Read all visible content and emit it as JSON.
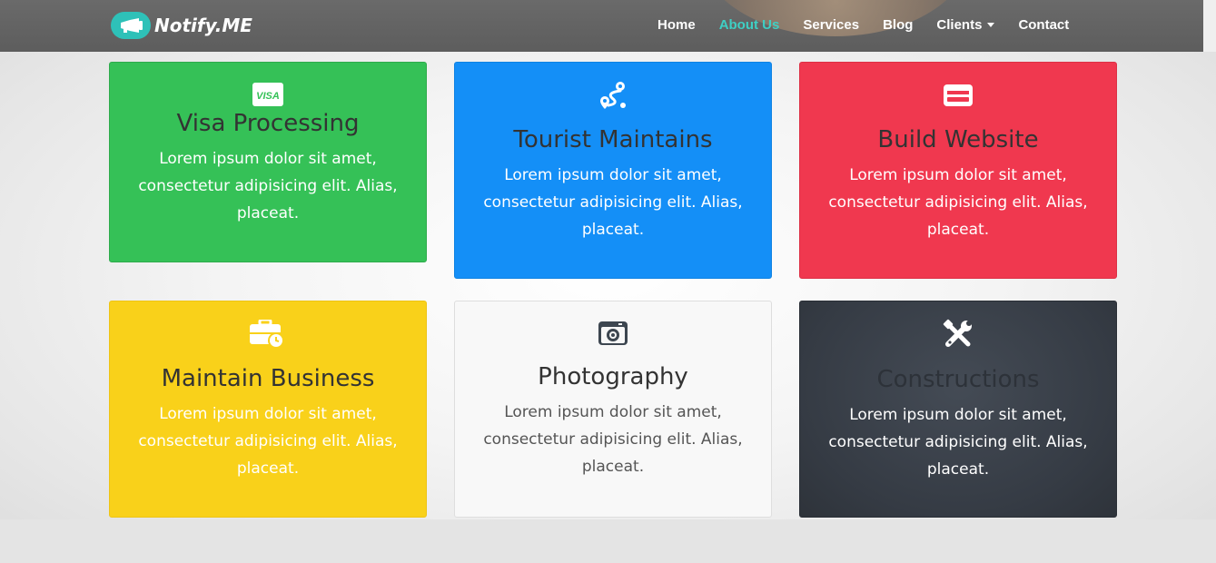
{
  "brand": {
    "name": "Notify.ME",
    "icon": "megaphone-icon",
    "accent": "#2ec1b8"
  },
  "nav": {
    "items": [
      {
        "label": "Home"
      },
      {
        "label": "About Us"
      },
      {
        "label": "Services"
      },
      {
        "label": "Blog"
      },
      {
        "label": "Clients"
      },
      {
        "label": "Contact"
      }
    ],
    "active": "About Us",
    "active_color": "#3ecfc4"
  },
  "cards": [
    {
      "title": "Visa Processing",
      "text": "Lorem ipsum dolor sit amet, consectetur adipisicing elit. Alias, placeat.",
      "icon": "visa-card-icon",
      "icon_text": "VISA",
      "color": "#35c157"
    },
    {
      "title": "Tourist Maintains",
      "text": "Lorem ipsum dolor sit amet, consectetur adipisicing elit. Alias, placeat.",
      "icon": "route-icon",
      "color": "#148ff7"
    },
    {
      "title": "Build Website",
      "text": "Lorem ipsum dolor sit amet, consectetur adipisicing elit. Alias, placeat.",
      "icon": "credit-card-icon",
      "color": "#f0384f"
    },
    {
      "title": "Maintain Business",
      "text": "Lorem ipsum dolor sit amet, consectetur adipisicing elit. Alias, placeat.",
      "icon": "business-time-icon",
      "color": "#f9d11a"
    },
    {
      "title": "Photography",
      "text": "Lorem ipsum dolor sit amet, consectetur adipisicing elit. Alias, placeat.",
      "icon": "camera-icon",
      "color": "#f8f8f8"
    },
    {
      "title": "Constructions",
      "text": "Lorem ipsum dolor sit amet, consectetur adipisicing elit. Alias, placeat.",
      "icon": "tools-icon",
      "color": "#3a4049"
    }
  ]
}
